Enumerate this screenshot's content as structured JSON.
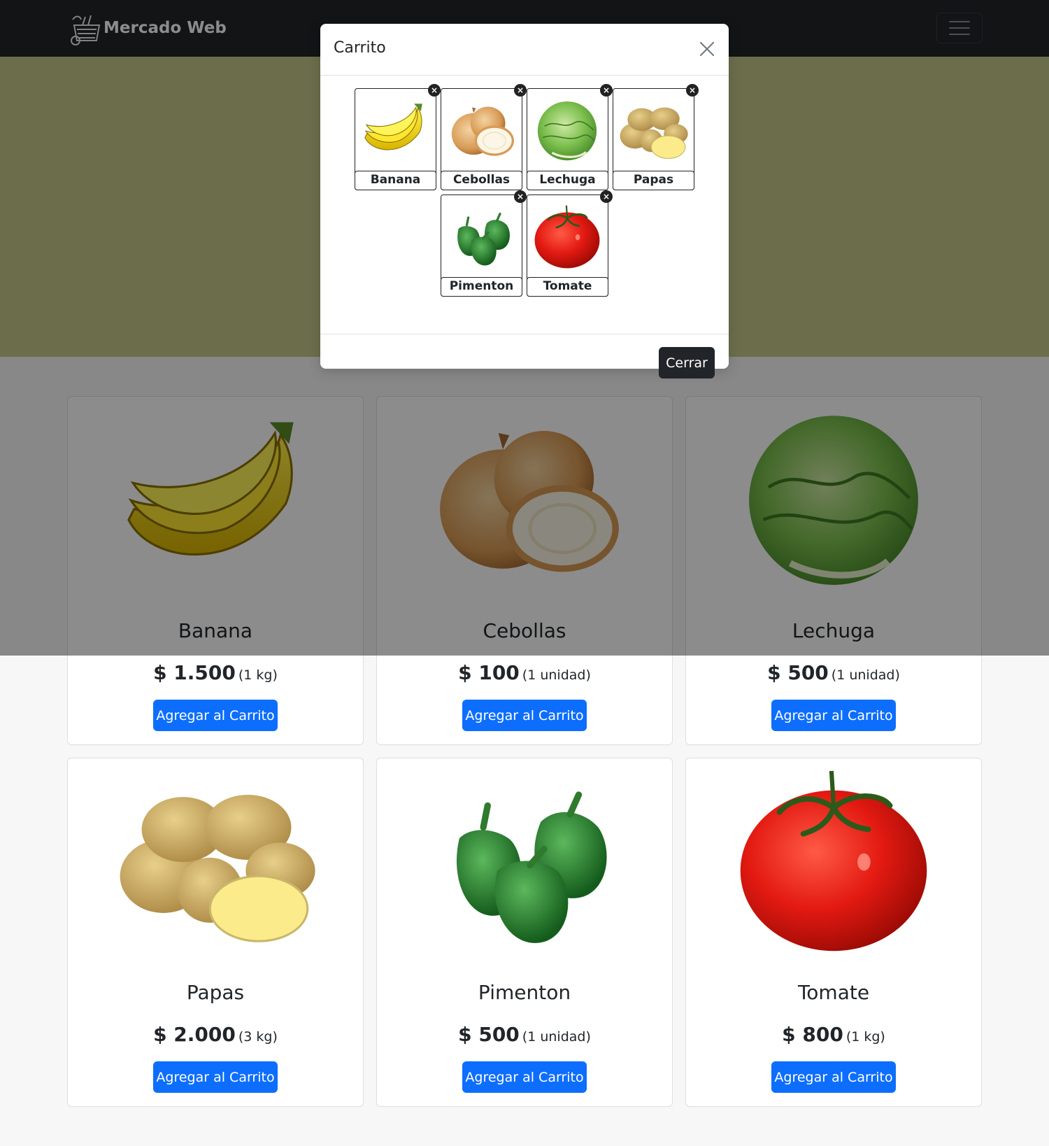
{
  "navbar": {
    "brand": "Mercado Web"
  },
  "products": [
    {
      "name": "Banana",
      "price": "$ 1.500",
      "unit": "(1 kg)",
      "button": "Agregar al Carrito",
      "icon": "banana-icon"
    },
    {
      "name": "Cebollas",
      "price": "$ 100",
      "unit": "(1 unidad)",
      "button": "Agregar al Carrito",
      "icon": "onion-icon"
    },
    {
      "name": "Lechuga",
      "price": "$ 500",
      "unit": "(1 unidad)",
      "button": "Agregar al Carrito",
      "icon": "lettuce-icon"
    },
    {
      "name": "Papas",
      "price": "$ 2.000",
      "unit": "(3 kg)",
      "button": "Agregar al Carrito",
      "icon": "potato-icon"
    },
    {
      "name": "Pimenton",
      "price": "$ 500",
      "unit": "(1 unidad)",
      "button": "Agregar al Carrito",
      "icon": "pepper-icon"
    },
    {
      "name": "Tomate",
      "price": "$ 800",
      "unit": "(1 kg)",
      "button": "Agregar al Carrito",
      "icon": "tomato-icon"
    }
  ],
  "modal": {
    "title": "Carrito",
    "close_button": "Cerrar",
    "remove_glyph": "×",
    "items": [
      {
        "label": "Banana"
      },
      {
        "label": "Cebollas"
      },
      {
        "label": "Lechuga"
      },
      {
        "label": "Papas"
      },
      {
        "label": "Pimenton"
      },
      {
        "label": "Tomate"
      }
    ]
  },
  "colors": {
    "navbar": "#212529",
    "hero": "#c5c989",
    "primary_button": "#0d6efd",
    "dark_button": "#212529",
    "backdrop": "rgba(0,0,0,0.45)"
  }
}
